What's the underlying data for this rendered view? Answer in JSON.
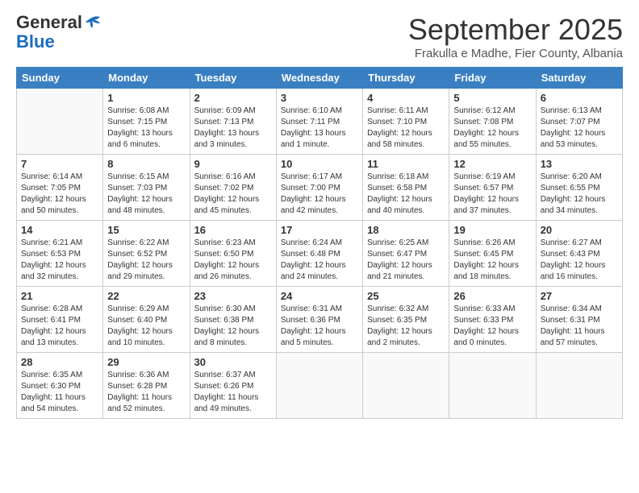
{
  "header": {
    "logo_line1": "General",
    "logo_line2": "Blue",
    "month_title": "September 2025",
    "location": "Frakulla e Madhe, Fier County, Albania"
  },
  "days_of_week": [
    "Sunday",
    "Monday",
    "Tuesday",
    "Wednesday",
    "Thursday",
    "Friday",
    "Saturday"
  ],
  "weeks": [
    [
      {
        "num": "",
        "sunrise": "",
        "sunset": "",
        "daylight": ""
      },
      {
        "num": "1",
        "sunrise": "Sunrise: 6:08 AM",
        "sunset": "Sunset: 7:15 PM",
        "daylight": "Daylight: 13 hours and 6 minutes."
      },
      {
        "num": "2",
        "sunrise": "Sunrise: 6:09 AM",
        "sunset": "Sunset: 7:13 PM",
        "daylight": "Daylight: 13 hours and 3 minutes."
      },
      {
        "num": "3",
        "sunrise": "Sunrise: 6:10 AM",
        "sunset": "Sunset: 7:11 PM",
        "daylight": "Daylight: 13 hours and 1 minute."
      },
      {
        "num": "4",
        "sunrise": "Sunrise: 6:11 AM",
        "sunset": "Sunset: 7:10 PM",
        "daylight": "Daylight: 12 hours and 58 minutes."
      },
      {
        "num": "5",
        "sunrise": "Sunrise: 6:12 AM",
        "sunset": "Sunset: 7:08 PM",
        "daylight": "Daylight: 12 hours and 55 minutes."
      },
      {
        "num": "6",
        "sunrise": "Sunrise: 6:13 AM",
        "sunset": "Sunset: 7:07 PM",
        "daylight": "Daylight: 12 hours and 53 minutes."
      }
    ],
    [
      {
        "num": "7",
        "sunrise": "Sunrise: 6:14 AM",
        "sunset": "Sunset: 7:05 PM",
        "daylight": "Daylight: 12 hours and 50 minutes."
      },
      {
        "num": "8",
        "sunrise": "Sunrise: 6:15 AM",
        "sunset": "Sunset: 7:03 PM",
        "daylight": "Daylight: 12 hours and 48 minutes."
      },
      {
        "num": "9",
        "sunrise": "Sunrise: 6:16 AM",
        "sunset": "Sunset: 7:02 PM",
        "daylight": "Daylight: 12 hours and 45 minutes."
      },
      {
        "num": "10",
        "sunrise": "Sunrise: 6:17 AM",
        "sunset": "Sunset: 7:00 PM",
        "daylight": "Daylight: 12 hours and 42 minutes."
      },
      {
        "num": "11",
        "sunrise": "Sunrise: 6:18 AM",
        "sunset": "Sunset: 6:58 PM",
        "daylight": "Daylight: 12 hours and 40 minutes."
      },
      {
        "num": "12",
        "sunrise": "Sunrise: 6:19 AM",
        "sunset": "Sunset: 6:57 PM",
        "daylight": "Daylight: 12 hours and 37 minutes."
      },
      {
        "num": "13",
        "sunrise": "Sunrise: 6:20 AM",
        "sunset": "Sunset: 6:55 PM",
        "daylight": "Daylight: 12 hours and 34 minutes."
      }
    ],
    [
      {
        "num": "14",
        "sunrise": "Sunrise: 6:21 AM",
        "sunset": "Sunset: 6:53 PM",
        "daylight": "Daylight: 12 hours and 32 minutes."
      },
      {
        "num": "15",
        "sunrise": "Sunrise: 6:22 AM",
        "sunset": "Sunset: 6:52 PM",
        "daylight": "Daylight: 12 hours and 29 minutes."
      },
      {
        "num": "16",
        "sunrise": "Sunrise: 6:23 AM",
        "sunset": "Sunset: 6:50 PM",
        "daylight": "Daylight: 12 hours and 26 minutes."
      },
      {
        "num": "17",
        "sunrise": "Sunrise: 6:24 AM",
        "sunset": "Sunset: 6:48 PM",
        "daylight": "Daylight: 12 hours and 24 minutes."
      },
      {
        "num": "18",
        "sunrise": "Sunrise: 6:25 AM",
        "sunset": "Sunset: 6:47 PM",
        "daylight": "Daylight: 12 hours and 21 minutes."
      },
      {
        "num": "19",
        "sunrise": "Sunrise: 6:26 AM",
        "sunset": "Sunset: 6:45 PM",
        "daylight": "Daylight: 12 hours and 18 minutes."
      },
      {
        "num": "20",
        "sunrise": "Sunrise: 6:27 AM",
        "sunset": "Sunset: 6:43 PM",
        "daylight": "Daylight: 12 hours and 16 minutes."
      }
    ],
    [
      {
        "num": "21",
        "sunrise": "Sunrise: 6:28 AM",
        "sunset": "Sunset: 6:41 PM",
        "daylight": "Daylight: 12 hours and 13 minutes."
      },
      {
        "num": "22",
        "sunrise": "Sunrise: 6:29 AM",
        "sunset": "Sunset: 6:40 PM",
        "daylight": "Daylight: 12 hours and 10 minutes."
      },
      {
        "num": "23",
        "sunrise": "Sunrise: 6:30 AM",
        "sunset": "Sunset: 6:38 PM",
        "daylight": "Daylight: 12 hours and 8 minutes."
      },
      {
        "num": "24",
        "sunrise": "Sunrise: 6:31 AM",
        "sunset": "Sunset: 6:36 PM",
        "daylight": "Daylight: 12 hours and 5 minutes."
      },
      {
        "num": "25",
        "sunrise": "Sunrise: 6:32 AM",
        "sunset": "Sunset: 6:35 PM",
        "daylight": "Daylight: 12 hours and 2 minutes."
      },
      {
        "num": "26",
        "sunrise": "Sunrise: 6:33 AM",
        "sunset": "Sunset: 6:33 PM",
        "daylight": "Daylight: 12 hours and 0 minutes."
      },
      {
        "num": "27",
        "sunrise": "Sunrise: 6:34 AM",
        "sunset": "Sunset: 6:31 PM",
        "daylight": "Daylight: 11 hours and 57 minutes."
      }
    ],
    [
      {
        "num": "28",
        "sunrise": "Sunrise: 6:35 AM",
        "sunset": "Sunset: 6:30 PM",
        "daylight": "Daylight: 11 hours and 54 minutes."
      },
      {
        "num": "29",
        "sunrise": "Sunrise: 6:36 AM",
        "sunset": "Sunset: 6:28 PM",
        "daylight": "Daylight: 11 hours and 52 minutes."
      },
      {
        "num": "30",
        "sunrise": "Sunrise: 6:37 AM",
        "sunset": "Sunset: 6:26 PM",
        "daylight": "Daylight: 11 hours and 49 minutes."
      },
      {
        "num": "",
        "sunrise": "",
        "sunset": "",
        "daylight": ""
      },
      {
        "num": "",
        "sunrise": "",
        "sunset": "",
        "daylight": ""
      },
      {
        "num": "",
        "sunrise": "",
        "sunset": "",
        "daylight": ""
      },
      {
        "num": "",
        "sunrise": "",
        "sunset": "",
        "daylight": ""
      }
    ]
  ]
}
